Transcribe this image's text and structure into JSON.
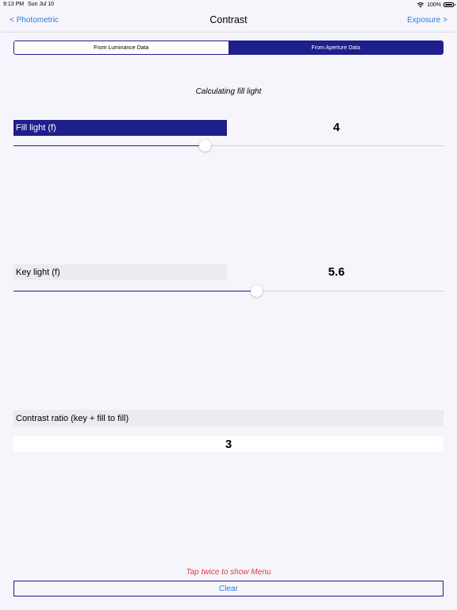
{
  "status_bar": {
    "time": "9:13 PM",
    "date": "Sun Jul 10",
    "battery": "100%",
    "icons": [
      "wifi-icon",
      "battery-icon"
    ]
  },
  "nav": {
    "back_label": "< Photometric",
    "title": "Contrast",
    "forward_label": "Exposure >"
  },
  "segments": {
    "items": [
      "From Luminance Data",
      "From Aperture Data"
    ],
    "selected_index": 1
  },
  "subtitle": "Calculating fill light",
  "fill_light": {
    "label": "Fill light (f)",
    "value": "4",
    "slider_fraction": 0.445
  },
  "key_light": {
    "label": "Key light (f)",
    "value": "5.6",
    "slider_fraction": 0.565
  },
  "contrast": {
    "label": "Contrast ratio (key + fill to fill)",
    "value": "3"
  },
  "footer": {
    "menu_hint": "Tap twice to show Menu",
    "clear_label": "Clear"
  },
  "colors": {
    "accent": "#1e1e8c",
    "link": "#2f7ce0",
    "hint": "#e23b3b",
    "background": "#f5f5fb"
  }
}
